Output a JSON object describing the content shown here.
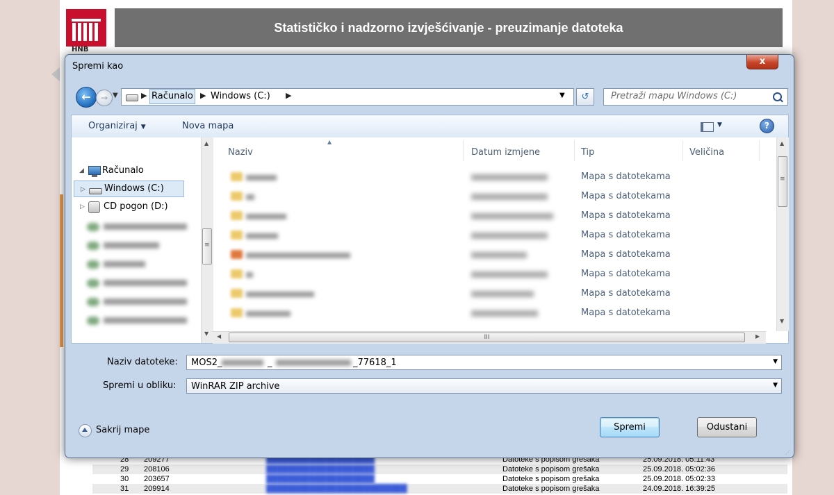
{
  "page": {
    "header_title": "Statističko i nadzorno izvješćivanje - preuzimanje datoteka",
    "logo_sub": "HNB",
    "table_rows": [
      {
        "num": "28",
        "id": "209277",
        "type": "Datoteke s popisom grešaka",
        "date": "25.09.2018. 05:11:43"
      },
      {
        "num": "29",
        "id": "208106",
        "type": "Datoteke s popisom grešaka",
        "date": "25.09.2018. 05:02:36"
      },
      {
        "num": "30",
        "id": "203657",
        "type": "Datoteke s popisom grešaka",
        "date": "25.09.2018. 05:02:33"
      },
      {
        "num": "31",
        "id": "209914",
        "type": "Datoteke s popisom grešaka",
        "date": "24.09.2018. 16:39:25"
      }
    ]
  },
  "dialog": {
    "title": "Spremi kao",
    "close_label": "x",
    "address": {
      "crumb_1": "Računalo",
      "crumb_2": "Windows (C:)",
      "search_placeholder": "Pretraži mapu Windows (C:)"
    },
    "toolbar": {
      "organize": "Organiziraj",
      "new_folder": "Nova mapa"
    },
    "tree": {
      "computer": "Računalo",
      "drive_c": "Windows (C:)",
      "drive_d": "CD pogon (D:)"
    },
    "columns": {
      "name": "Naziv",
      "date": "Datum izmjene",
      "type": "Tip",
      "size": "Veličina"
    },
    "files": [
      {
        "type": "Mapa s datotekama"
      },
      {
        "type": "Mapa s datotekama"
      },
      {
        "type": "Mapa s datotekama"
      },
      {
        "type": "Mapa s datotekama"
      },
      {
        "type": "Mapa s datotekama"
      },
      {
        "type": "Mapa s datotekama"
      },
      {
        "type": "Mapa s datotekama"
      },
      {
        "type": "Mapa s datotekama"
      }
    ],
    "filename_label": "Naziv datoteke:",
    "filename_prefix": "MOS2_",
    "filename_sep": "_",
    "filename_suffix": "_77618_1",
    "format_label": "Spremi u obliku:",
    "format_value": "WinRAR ZIP archive",
    "hide_folders": "Sakrij mape",
    "save_button": "Spremi",
    "cancel_button": "Odustani",
    "scroll_grip": "≡",
    "hscroll_grip": "III"
  },
  "colors": {
    "header_bg": "#707070",
    "logo_red": "#c8102e",
    "dialog_frame": "#c6d6ea",
    "close_red": "#c7462a",
    "link_blue": "#3a5bd8"
  }
}
